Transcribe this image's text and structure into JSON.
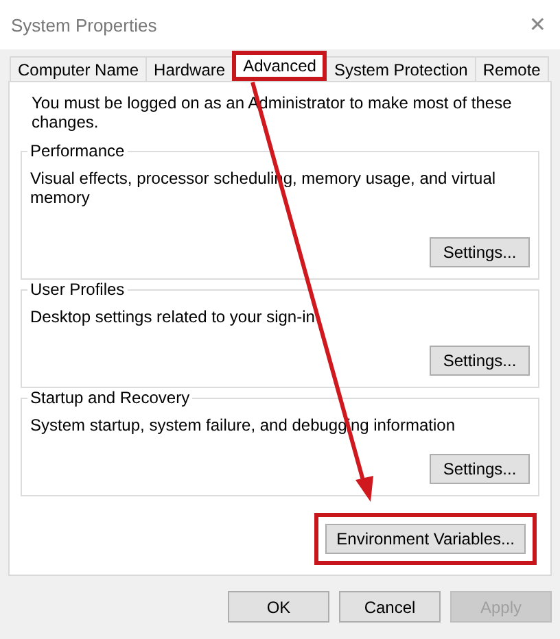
{
  "window": {
    "title": "System Properties",
    "close": "✕"
  },
  "tabs": [
    {
      "label": "Computer Name",
      "selected": false,
      "highlighted": false
    },
    {
      "label": "Hardware",
      "selected": false,
      "highlighted": false
    },
    {
      "label": "Advanced",
      "selected": true,
      "highlighted": true
    },
    {
      "label": "System Protection",
      "selected": false,
      "highlighted": false
    },
    {
      "label": "Remote",
      "selected": false,
      "highlighted": false
    }
  ],
  "notice": "You must be logged on as an Administrator to make most of these changes.",
  "groups": [
    {
      "title": "Performance",
      "description": "Visual effects, processor scheduling, memory usage, and virtual memory",
      "button": "Settings..."
    },
    {
      "title": "User Profiles",
      "description": "Desktop settings related to your sign-in",
      "button": "Settings..."
    },
    {
      "title": "Startup and Recovery",
      "description": "System startup, system failure, and debugging information",
      "button": "Settings..."
    }
  ],
  "environment_button": {
    "label": "Environment Variables...",
    "highlighted": true
  },
  "buttons": [
    {
      "label": "OK",
      "disabled": false
    },
    {
      "label": "Cancel",
      "disabled": false
    },
    {
      "label": "Apply",
      "disabled": true
    }
  ]
}
